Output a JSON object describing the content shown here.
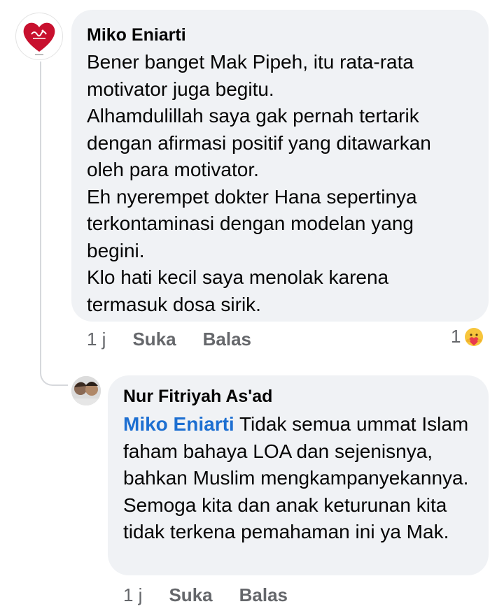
{
  "comment": {
    "author": "Miko Eniarti",
    "avatar_icon": "heart-calligraphy-icon",
    "text": "Bener banget Mak Pipeh, itu rata-rata\nmotivator juga begitu.\nAlhamdulillah saya gak pernah tertarik\ndengan afirmasi positif yang ditawarkan\noleh para motivator.\nEh nyerempet dokter Hana sepertinya\nterkontaminasi dengan modelan yang\nbegini.\nKlo hati kecil saya menolak karena\ntermasuk dosa sirik.",
    "time": "1 j",
    "like_label": "Suka",
    "reply_label": "Balas",
    "reaction_count": "1",
    "reaction_icon": "care-emoji-icon"
  },
  "reply": {
    "author": "Nur Fitriyah As'ad",
    "avatar_icon": "user-photo-icon",
    "mention": "Miko Eniarti",
    "text": " Tidak semua ummat Islam faham bahaya LOA dan sejenisnya, bahkan Muslim mengkampanyekannya. Semoga kita dan anak keturunan kita tidak terkena pemahaman ini ya Mak.",
    "time": "1 j",
    "like_label": "Suka",
    "reply_label": "Balas"
  },
  "colors": {
    "bubble": "#f0f2f5",
    "mention": "#1d6fd1",
    "meta": "#65676b",
    "heart": "#c8102e"
  }
}
